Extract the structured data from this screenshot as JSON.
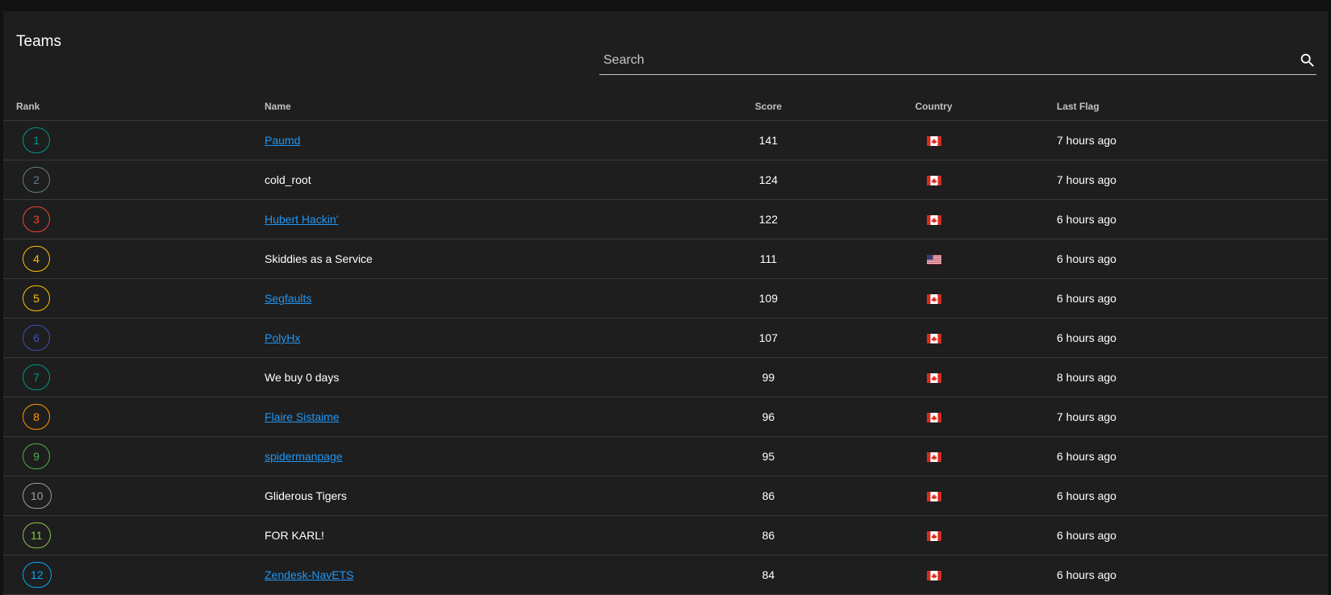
{
  "card": {
    "title": "Teams"
  },
  "search": {
    "placeholder": "Search"
  },
  "columns": {
    "rank": "Rank",
    "name": "Name",
    "score": "Score",
    "country": "Country",
    "last_flag": "Last Flag"
  },
  "rows": [
    {
      "rank": "1",
      "rank_color": "#009688",
      "name": "Paumd",
      "linked": true,
      "score": "141",
      "country_flag": "canada-flag-icon",
      "last_flag": "7 hours ago"
    },
    {
      "rank": "2",
      "rank_color": "#607d8b",
      "name": "cold_root",
      "linked": false,
      "score": "124",
      "country_flag": "canada-flag-icon",
      "last_flag": "7 hours ago"
    },
    {
      "rank": "3",
      "rank_color": "#f44336",
      "name": "Hubert Hackin'",
      "linked": true,
      "score": "122",
      "country_flag": "canada-flag-icon",
      "last_flag": "6 hours ago"
    },
    {
      "rank": "4",
      "rank_color": "#ffc107",
      "name": "Skiddies as a Service",
      "linked": false,
      "score": "111",
      "country_flag": "usa-flag-icon",
      "last_flag": "6 hours ago"
    },
    {
      "rank": "5",
      "rank_color": "#ffc107",
      "name": "Segfaults",
      "linked": true,
      "score": "109",
      "country_flag": "canada-flag-icon",
      "last_flag": "6 hours ago"
    },
    {
      "rank": "6",
      "rank_color": "#3f51b5",
      "name": "PolyHx",
      "linked": true,
      "score": "107",
      "country_flag": "canada-flag-icon",
      "last_flag": "6 hours ago"
    },
    {
      "rank": "7",
      "rank_color": "#009688",
      "name": "We buy 0 days",
      "linked": false,
      "score": "99",
      "country_flag": "canada-flag-icon",
      "last_flag": "8 hours ago"
    },
    {
      "rank": "8",
      "rank_color": "#ff9800",
      "name": "Flaire Sistaime",
      "linked": true,
      "score": "96",
      "country_flag": "canada-flag-icon",
      "last_flag": "7 hours ago"
    },
    {
      "rank": "9",
      "rank_color": "#4caf50",
      "name": "spidermanpage",
      "linked": true,
      "score": "95",
      "country_flag": "canada-flag-icon",
      "last_flag": "6 hours ago"
    },
    {
      "rank": "10",
      "rank_color": "#9e9e9e",
      "name": "Gliderous Tigers",
      "linked": false,
      "score": "86",
      "country_flag": "canada-flag-icon",
      "last_flag": "6 hours ago"
    },
    {
      "rank": "11",
      "rank_color": "#8bc34a",
      "name": "FOR KARL!",
      "linked": false,
      "score": "86",
      "country_flag": "canada-flag-icon",
      "last_flag": "6 hours ago"
    },
    {
      "rank": "12",
      "rank_color": "#03a9f4",
      "name": "Zendesk-NavETS",
      "linked": true,
      "score": "84",
      "country_flag": "canada-flag-icon",
      "last_flag": "6 hours ago"
    }
  ]
}
